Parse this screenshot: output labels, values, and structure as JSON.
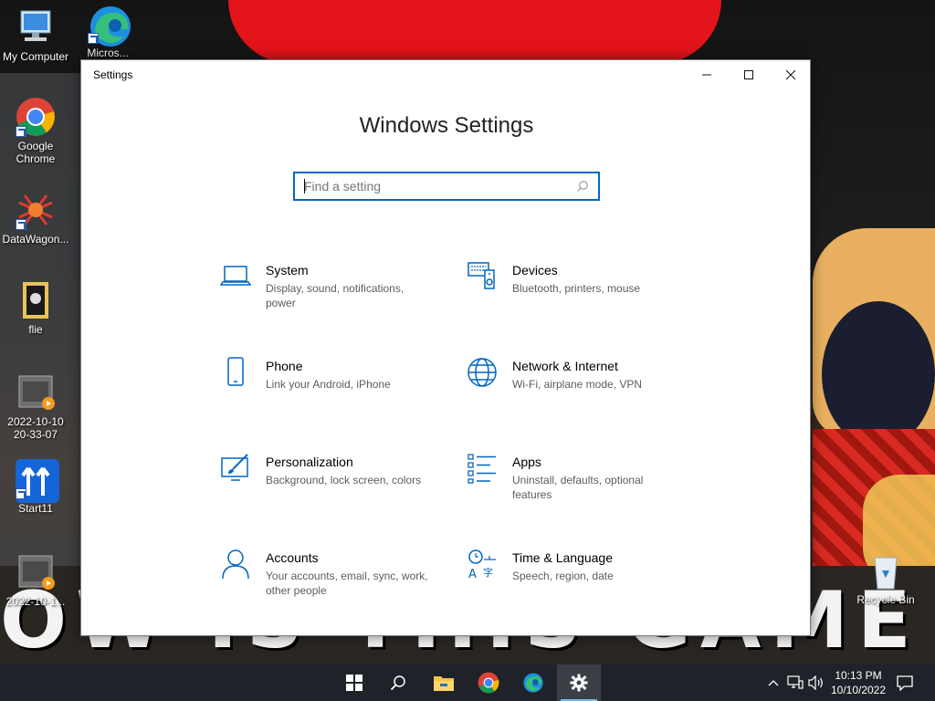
{
  "desktop": {
    "icons": [
      {
        "label": "My Computer"
      },
      {
        "label": "Micros..."
      },
      {
        "label": "Google Chrome"
      },
      {
        "label": "DataWagon..."
      },
      {
        "label": "flie"
      },
      {
        "label": "2022-10-10 20-33-07"
      },
      {
        "label": "Start11"
      },
      {
        "label": "2022-10-1..."
      },
      {
        "label": "Recycle Bin"
      }
    ],
    "wallpaper_text": "OW IS THIS GAME SO GOO"
  },
  "window": {
    "title": "Settings",
    "heading": "Windows Settings",
    "search_placeholder": "Find a setting",
    "tiles": [
      {
        "name": "System",
        "desc": "Display, sound, notifications, power",
        "icon": "laptop-icon"
      },
      {
        "name": "Devices",
        "desc": "Bluetooth, printers, mouse",
        "icon": "keyboard-speaker-icon"
      },
      {
        "name": "Phone",
        "desc": "Link your Android, iPhone",
        "icon": "phone-icon"
      },
      {
        "name": "Network & Internet",
        "desc": "Wi-Fi, airplane mode, VPN",
        "icon": "globe-icon"
      },
      {
        "name": "Personalization",
        "desc": "Background, lock screen, colors",
        "icon": "paintbrush-icon"
      },
      {
        "name": "Apps",
        "desc": "Uninstall, defaults, optional features",
        "icon": "list-icon"
      },
      {
        "name": "Accounts",
        "desc": "Your accounts, email, sync, work, other people",
        "icon": "person-icon"
      },
      {
        "name": "Time & Language",
        "desc": "Speech, region, date",
        "icon": "language-icon"
      }
    ]
  },
  "taskbar": {
    "time": "10:13 PM",
    "date": "10/10/2022"
  },
  "colors": {
    "accent": "#0067c0",
    "taskbar": "#1f2329"
  }
}
